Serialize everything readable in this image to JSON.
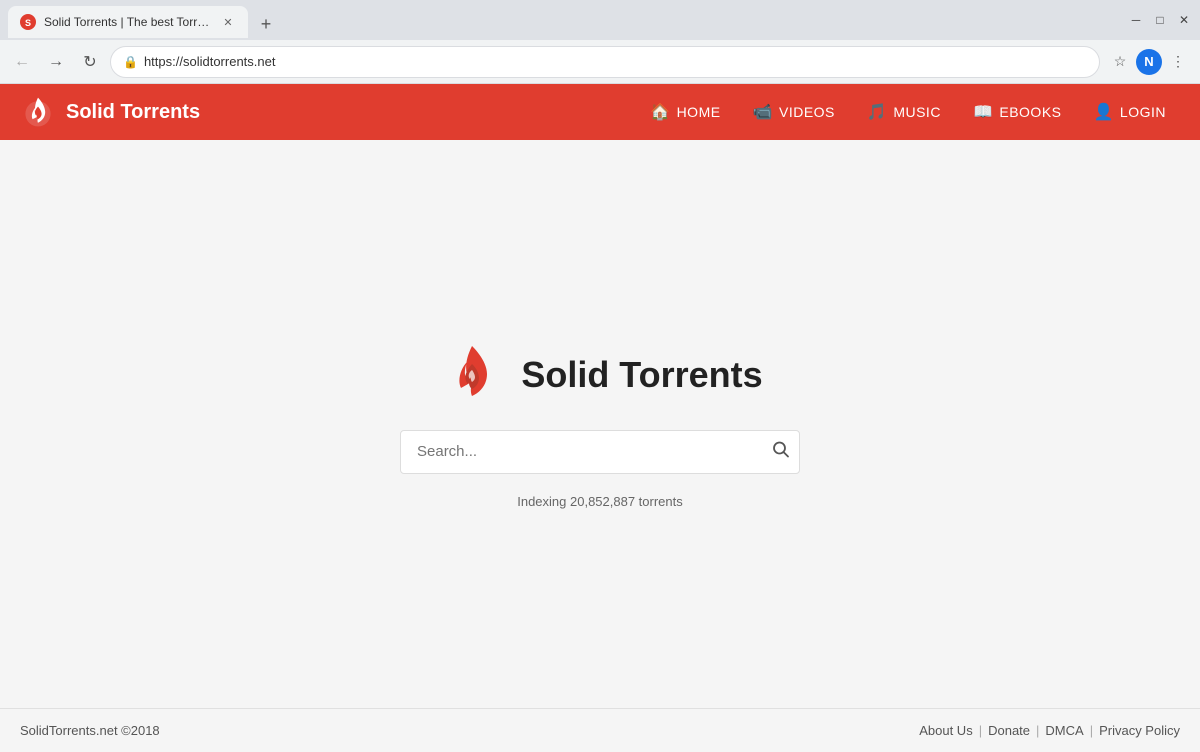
{
  "browser": {
    "tab_title": "Solid Torrents | The best Torrent",
    "url": "https://solidtorrents.net",
    "profile_letter": "N",
    "new_tab_symbol": "+",
    "back_symbol": "←",
    "forward_symbol": "→",
    "reload_symbol": "↻"
  },
  "site": {
    "name": "Solid Torrents",
    "header_bg": "#e03d2f",
    "nav": [
      {
        "label": "HOME",
        "icon": "🏠"
      },
      {
        "label": "VIDEOS",
        "icon": "📹"
      },
      {
        "label": "MUSIC",
        "icon": "🎵"
      },
      {
        "label": "EBOOKS",
        "icon": "📖"
      },
      {
        "label": "LOGIN",
        "icon": "👤"
      }
    ],
    "hero_title": "Solid Torrents",
    "search_placeholder": "Search...",
    "indexing_text": "Indexing 20,852,887 torrents",
    "footer_copyright": "SolidTorrents.net ©2018",
    "footer_links": [
      {
        "label": "About Us"
      },
      {
        "label": "Donate"
      },
      {
        "label": "DMCA"
      },
      {
        "label": "Privacy Policy"
      }
    ]
  }
}
